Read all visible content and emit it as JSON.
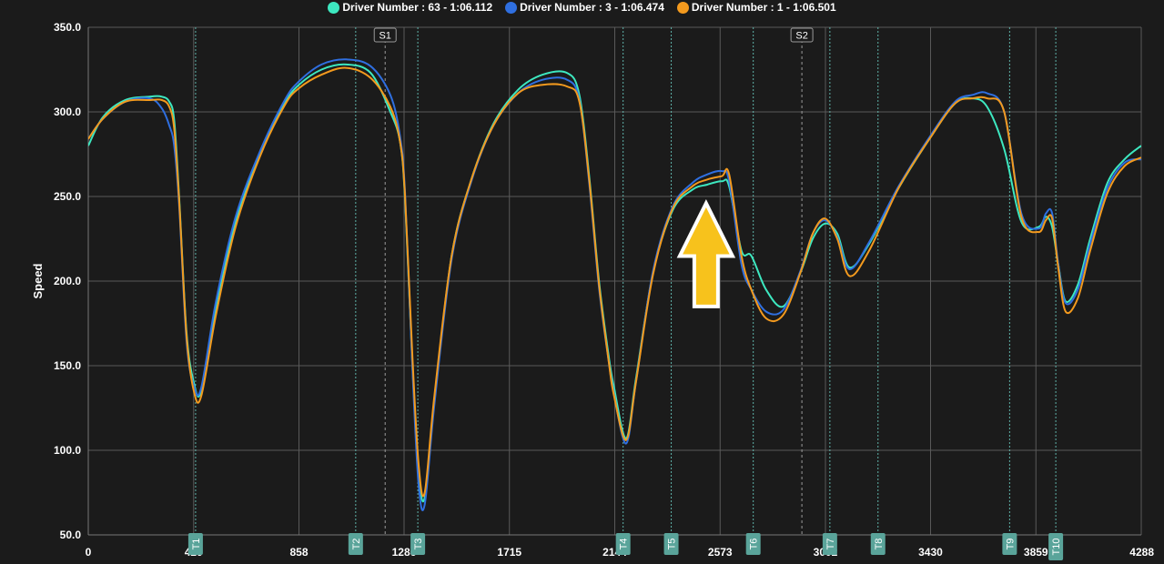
{
  "legend": {
    "items": [
      {
        "label": "Driver Number : 63 - 1:06.112",
        "color": "#3de8c0"
      },
      {
        "label": "Driver Number : 3 - 1:06.474",
        "color": "#2f6fe0"
      },
      {
        "label": "Driver Number : 1 - 1:06.501",
        "color": "#f39a1e"
      }
    ]
  },
  "chart_data": {
    "type": "line",
    "title": "",
    "xlabel": "",
    "ylabel": "Speed",
    "xlim": [
      0,
      4288
    ],
    "ylim": [
      50,
      350
    ],
    "grid": true,
    "legend_position": "top-center",
    "x_ticks": [
      {
        "value": 0,
        "label": "0"
      },
      {
        "value": 429,
        "label": "429"
      },
      {
        "value": 858,
        "label": "858"
      },
      {
        "value": 1286,
        "label": "1286"
      },
      {
        "value": 1715,
        "label": "1715"
      },
      {
        "value": 2144,
        "label": "2144"
      },
      {
        "value": 2573,
        "label": "2573"
      },
      {
        "value": 3002,
        "label": "3002"
      },
      {
        "value": 3430,
        "label": "3430"
      },
      {
        "value": 3859,
        "label": "3859"
      },
      {
        "value": 4288,
        "label": "4288"
      }
    ],
    "y_ticks": [
      {
        "value": 50,
        "label": "50.0"
      },
      {
        "value": 100,
        "label": "100.0"
      },
      {
        "value": 150,
        "label": "150.0"
      },
      {
        "value": 200,
        "label": "200.0"
      },
      {
        "value": 250,
        "label": "250.0"
      },
      {
        "value": 300,
        "label": "300.0"
      },
      {
        "value": 350,
        "label": "350.0"
      }
    ],
    "sectors": [
      {
        "label": "S1",
        "x": 1209
      },
      {
        "label": "S2",
        "x": 2906
      }
    ],
    "turns": [
      {
        "label": "T1",
        "x": 437
      },
      {
        "label": "T2",
        "x": 1089
      },
      {
        "label": "T3",
        "x": 1342
      },
      {
        "label": "T4",
        "x": 2178
      },
      {
        "label": "T5",
        "x": 2374
      },
      {
        "label": "T6",
        "x": 2708
      },
      {
        "label": "T7",
        "x": 3020
      },
      {
        "label": "T8",
        "x": 3216
      },
      {
        "label": "T9",
        "x": 3752
      },
      {
        "label": "T10",
        "x": 3940
      }
    ],
    "annotation": {
      "type": "arrow",
      "color": "#f7c21c",
      "x": 2516,
      "y_tip": 246,
      "y_tail": 185
    },
    "series": [
      {
        "name": "Driver Number : 63 - 1:06.112",
        "color": "#3de8c0",
        "x": [
          0,
          60,
          150,
          250,
          300,
          330,
          350,
          370,
          400,
          430,
          460,
          520,
          600,
          700,
          800,
          858,
          950,
          1050,
          1150,
          1230,
          1270,
          1290,
          1320,
          1345,
          1370,
          1410,
          1480,
          1560,
          1650,
          1750,
          1850,
          1950,
          2000,
          2040,
          2080,
          2120,
          2140,
          2190,
          2230,
          2300,
          2380,
          2460,
          2520,
          2580,
          2610,
          2660,
          2700,
          2760,
          2830,
          2900,
          2950,
          3000,
          3050,
          3100,
          3180,
          3300,
          3430,
          3530,
          3600,
          3660,
          3730,
          3800,
          3870,
          3900,
          3925,
          3950,
          3980,
          4030,
          4080,
          4150,
          4220,
          4288
        ],
        "y": [
          280,
          297,
          307,
          309,
          309,
          306,
          295,
          250,
          170,
          140,
          135,
          185,
          235,
          275,
          305,
          316,
          325,
          328,
          323,
          300,
          282,
          248,
          150,
          88,
          72,
          130,
          215,
          260,
          293,
          313,
          322,
          323,
          310,
          262,
          200,
          155,
          138,
          107,
          142,
          205,
          242,
          254,
          257,
          259,
          256,
          218,
          215,
          195,
          185,
          205,
          225,
          234,
          228,
          208,
          222,
          255,
          285,
          305,
          308,
          303,
          278,
          235,
          232,
          238,
          232,
          210,
          188,
          198,
          225,
          258,
          272,
          280
        ]
      },
      {
        "name": "Driver Number : 3 - 1:06.474",
        "color": "#2f6fe0",
        "x": [
          0,
          60,
          150,
          250,
          300,
          330,
          350,
          370,
          400,
          430,
          460,
          520,
          600,
          700,
          800,
          858,
          950,
          1050,
          1150,
          1230,
          1270,
          1290,
          1320,
          1345,
          1370,
          1410,
          1480,
          1560,
          1650,
          1750,
          1850,
          1950,
          2000,
          2040,
          2080,
          2120,
          2140,
          2190,
          2230,
          2300,
          2380,
          2460,
          2520,
          2580,
          2610,
          2660,
          2700,
          2760,
          2830,
          2900,
          2950,
          3000,
          3050,
          3100,
          3180,
          3300,
          3430,
          3530,
          3600,
          3660,
          3730,
          3800,
          3870,
          3900,
          3925,
          3950,
          3980,
          4030,
          4080,
          4150,
          4220,
          4288
        ],
        "y": [
          284,
          296,
          306,
          308,
          302,
          292,
          280,
          245,
          165,
          138,
          137,
          188,
          238,
          277,
          307,
          318,
          328,
          331,
          327,
          310,
          285,
          252,
          148,
          80,
          68,
          128,
          213,
          259,
          292,
          311,
          319,
          319,
          307,
          258,
          196,
          152,
          134,
          104,
          140,
          206,
          244,
          258,
          263,
          265,
          259,
          210,
          195,
          182,
          183,
          206,
          228,
          236,
          226,
          207,
          223,
          256,
          286,
          306,
          310,
          311,
          300,
          240,
          231,
          240,
          240,
          210,
          187,
          195,
          222,
          255,
          270,
          272
        ]
      },
      {
        "name": "Driver Number : 1 - 1:06.501",
        "color": "#f39a1e",
        "x": [
          0,
          60,
          150,
          250,
          300,
          330,
          350,
          370,
          400,
          430,
          460,
          520,
          600,
          700,
          800,
          858,
          950,
          1050,
          1150,
          1230,
          1270,
          1290,
          1320,
          1345,
          1370,
          1410,
          1480,
          1560,
          1650,
          1750,
          1850,
          1950,
          2000,
          2040,
          2080,
          2120,
          2140,
          2190,
          2230,
          2300,
          2380,
          2460,
          2520,
          2580,
          2610,
          2660,
          2700,
          2760,
          2830,
          2900,
          2950,
          3000,
          3050,
          3100,
          3180,
          3300,
          3430,
          3530,
          3600,
          3660,
          3730,
          3800,
          3870,
          3900,
          3925,
          3950,
          3980,
          4030,
          4080,
          4150,
          4220,
          4288
        ],
        "y": [
          284,
          296,
          306,
          307,
          307,
          303,
          290,
          248,
          168,
          135,
          132,
          180,
          232,
          274,
          304,
          314,
          322,
          326,
          320,
          303,
          282,
          250,
          155,
          92,
          75,
          133,
          215,
          260,
          292,
          311,
          316,
          315,
          306,
          260,
          198,
          152,
          133,
          106,
          140,
          204,
          243,
          256,
          260,
          262,
          263,
          215,
          195,
          178,
          180,
          205,
          228,
          237,
          225,
          203,
          218,
          255,
          285,
          305,
          308,
          308,
          300,
          238,
          229,
          236,
          237,
          208,
          182,
          190,
          218,
          252,
          268,
          273
        ]
      }
    ]
  }
}
